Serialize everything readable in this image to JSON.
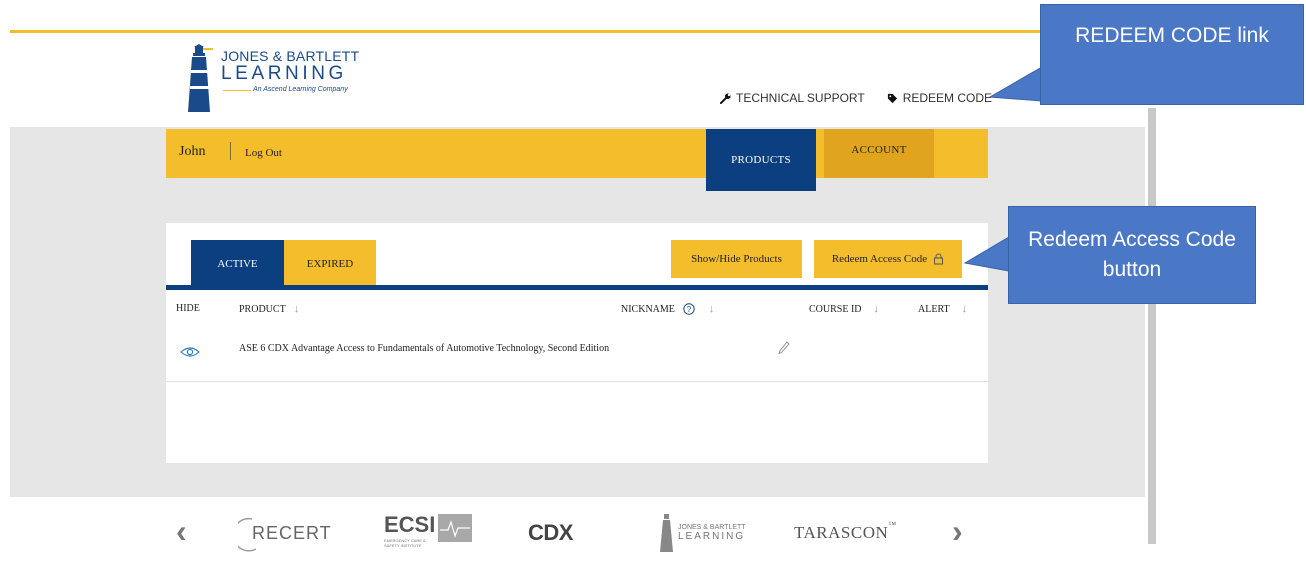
{
  "header": {
    "logo": {
      "line1": "JONES & BARTLETT",
      "line2": "LEARNING",
      "tagline": "An Ascend Learning Company"
    },
    "utility_links": [
      {
        "label": "TECHNICAL SUPPORT",
        "icon": "wrench-icon"
      },
      {
        "label": "REDEEM CODE",
        "icon": "tag-icon"
      }
    ]
  },
  "nav": {
    "user_name": "John",
    "logout_label": "Log Out",
    "products_label": "PRODUCTS",
    "account_label": "ACCOUNT"
  },
  "products": {
    "tabs": [
      {
        "label": "ACTIVE",
        "active": true
      },
      {
        "label": "EXPIRED",
        "active": false
      }
    ],
    "show_hide_label": "Show/Hide Products",
    "redeem_label": "Redeem Access Code",
    "columns": [
      "HIDE",
      "PRODUCT",
      "NICKNAME",
      "COURSE ID",
      "ALERT"
    ],
    "rows": [
      {
        "product": "ASE 6 CDX Advantage Access to Fundamentals of Automotive Technology, Second Edition",
        "nickname": "",
        "course_id": "",
        "alert": ""
      }
    ]
  },
  "partners": [
    {
      "name": "RECERT"
    },
    {
      "name": "ECSI",
      "sub": "EMERGENCY CARE & SAFETY INSTITUTE"
    },
    {
      "name": "CDX"
    },
    {
      "name": "JONES & BARTLETT",
      "sub": "LEARNING"
    },
    {
      "name": "TARASCON"
    }
  ],
  "annotations": {
    "callout1": "REDEEM CODE link",
    "callout2": "Redeem Access Code button"
  },
  "colors": {
    "accent_yellow": "#f3bd2b",
    "navy": "#0c3f7f",
    "callout_blue": "#4a78c6"
  }
}
